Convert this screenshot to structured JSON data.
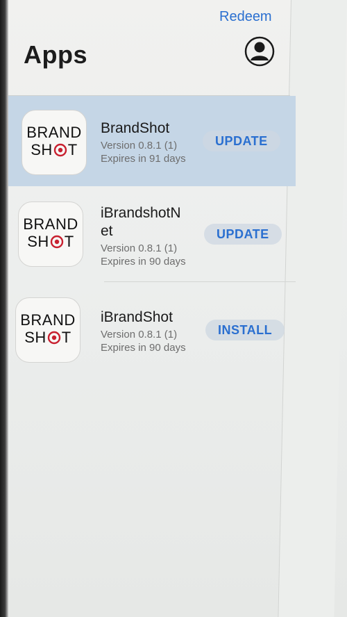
{
  "header": {
    "redeem_label": "Redeem",
    "title": "Apps",
    "account_icon": "person-circle-icon"
  },
  "apps": [
    {
      "name": "BrandShot",
      "version": "Version 0.8.1 (1)",
      "expires": "Expires in 91 days",
      "action": "UPDATE",
      "icon_text_top": "BRAND",
      "icon_text_bottom_left": "SH",
      "icon_text_bottom_right": "T",
      "selected": true
    },
    {
      "name": "iBrandshotN",
      "name_line2": "et",
      "version": "Version 0.8.1 (1)",
      "expires": "Expires in 90 days",
      "action": "UPDATE",
      "icon_text_top": "BRAND",
      "icon_text_bottom_left": "SH",
      "icon_text_bottom_right": "T",
      "selected": false
    },
    {
      "name": "iBrandShot",
      "version": "Version 0.8.1 (1)",
      "expires": "Expires in 90 days",
      "action": "INSTALL",
      "icon_text_top": "BRAND",
      "icon_text_bottom_left": "SH",
      "icon_text_bottom_right": "T",
      "selected": false
    }
  ],
  "colors": {
    "accent": "#2a6fd0",
    "selected_row": "#c5d6e6",
    "logo_red": "#c8202f"
  }
}
